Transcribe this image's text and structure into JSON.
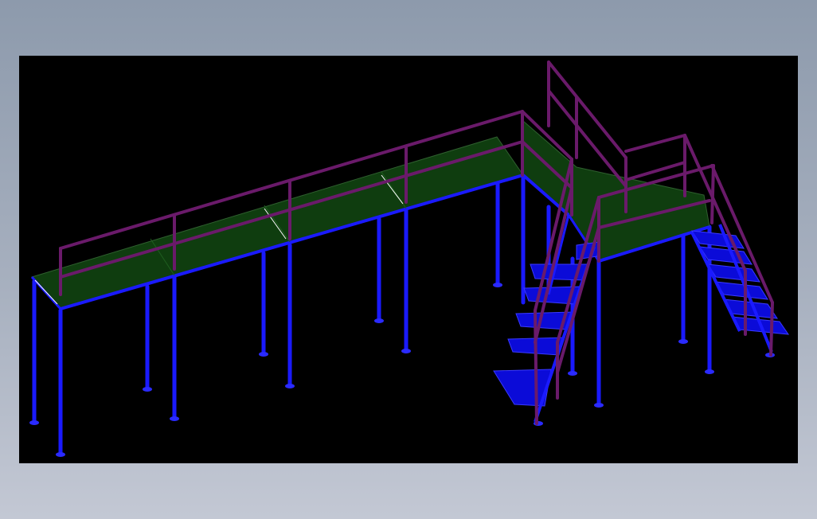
{
  "colors": {
    "background_top": "#8d9aac",
    "background_bottom": "#c3c8d4",
    "viewport": "#000000",
    "columns": "#1a1aff",
    "column_feet": "#2a2aff",
    "deck": "#0f3d0f",
    "deck_edge": "#2f5f2f",
    "railing": "#6a1a6a",
    "stair_treads": "#0b0bd8",
    "highlight": "#ffffff"
  },
  "model": {
    "description_icon": "steel-platform-with-stairs-icon"
  }
}
